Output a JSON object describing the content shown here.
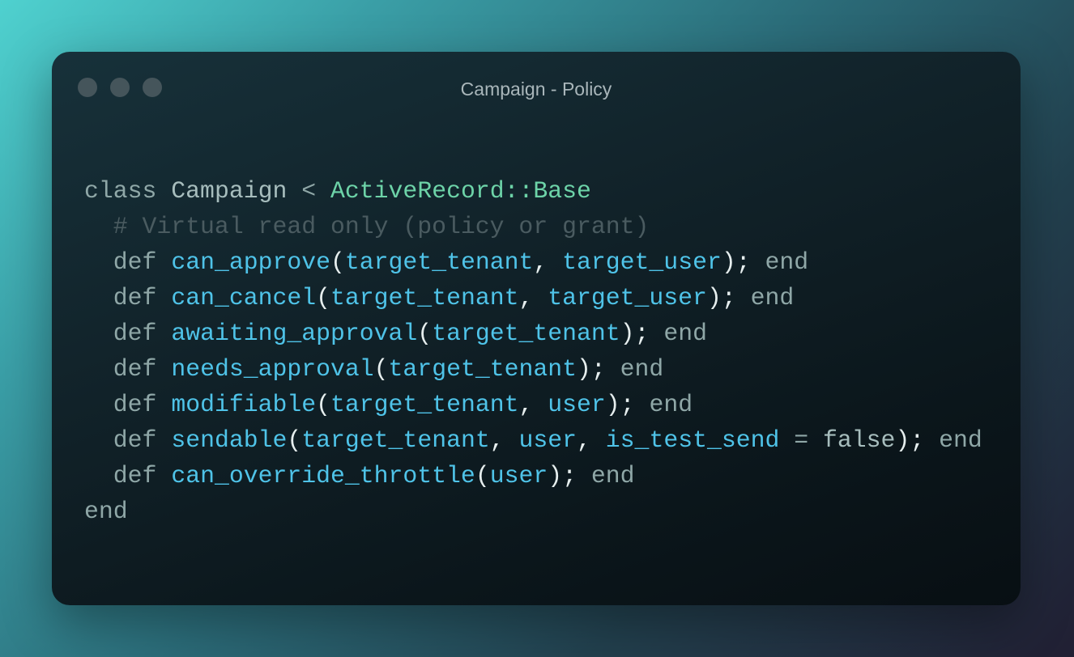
{
  "window": {
    "title": "Campaign - Policy",
    "traffic_light_color": "#45555b"
  },
  "code": {
    "language": "ruby",
    "line1": {
      "kw_class": "class",
      "class_name": "Campaign",
      "op_lt": "<",
      "base": "ActiveRecord::Base"
    },
    "comment": "# Virtual read only (policy or grant)",
    "line3": {
      "def": "def",
      "name": "can_approve",
      "open": "(",
      "p1": "target_tenant",
      "sep": ", ",
      "p2": "target_user",
      "close": ");",
      "end": "end"
    },
    "line4": {
      "def": "def",
      "name": "can_cancel",
      "open": "(",
      "p1": "target_tenant",
      "sep": ", ",
      "p2": "target_user",
      "close": ");",
      "end": "end"
    },
    "line5": {
      "def": "def",
      "name": "awaiting_approval",
      "open": "(",
      "p1": "target_tenant",
      "close": ");",
      "end": "end"
    },
    "line6": {
      "def": "def",
      "name": "needs_approval",
      "open": "(",
      "p1": "target_tenant",
      "close": ");",
      "end": "end"
    },
    "line7": {
      "def": "def",
      "name": "modifiable",
      "open": "(",
      "p1": "target_tenant",
      "sep": ", ",
      "p2": "user",
      "close": ");",
      "end": "end"
    },
    "line8": {
      "def": "def",
      "name": "sendable",
      "open": "(",
      "p1": "target_tenant",
      "sep1": ", ",
      "p2": "user",
      "sep2": ", ",
      "p3": "is_test_send",
      "eq": " = ",
      "default": "false",
      "close": ");",
      "end": "end"
    },
    "line9": {
      "def": "def",
      "name": "can_override_throttle",
      "open": "(",
      "p1": "user",
      "close": ");",
      "end": "end"
    },
    "line10": {
      "end": "end"
    }
  },
  "colors": {
    "keyword": "#8fa7a7",
    "method": "#4fc3e8",
    "base_class": "#6dd3a8",
    "comment": "#4a5b60",
    "punctuation": "#e6eeee"
  }
}
